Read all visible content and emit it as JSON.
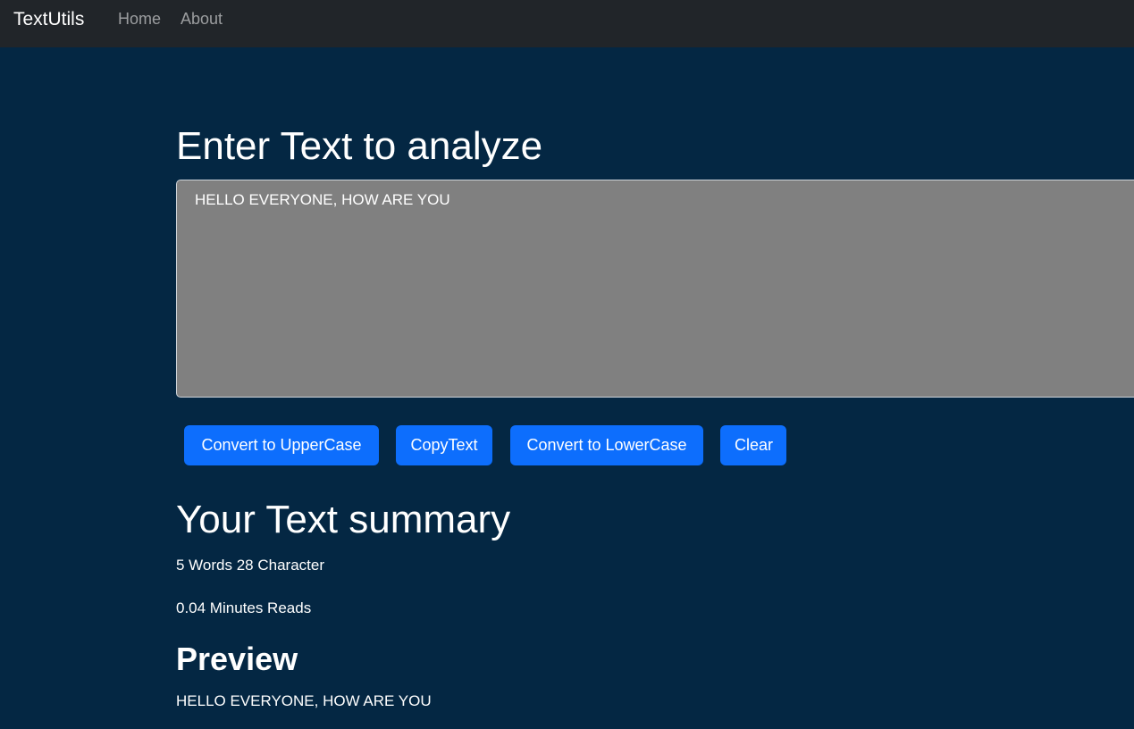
{
  "navbar": {
    "brand": "TextUtils",
    "links": [
      {
        "label": "Home"
      },
      {
        "label": "About"
      }
    ]
  },
  "main": {
    "heading": "Enter Text to analyze",
    "textarea_value": "HELLO EVERYONE, HOW ARE YOU",
    "buttons": {
      "upper": "Convert to UpperCase",
      "copy": "CopyText",
      "lower": "Convert to LowerCase",
      "clear": "Clear"
    }
  },
  "summary": {
    "heading": "Your Text summary",
    "words_chars": "5 Words 28 Character",
    "read_time": "0.04 Minutes Reads"
  },
  "preview": {
    "heading": "Preview",
    "text": "HELLO EVERYONE, HOW ARE YOU"
  },
  "colors": {
    "page_bg": "#042743",
    "navbar_bg": "#212529",
    "textarea_bg": "#808080",
    "button_bg": "#0d6efd"
  }
}
